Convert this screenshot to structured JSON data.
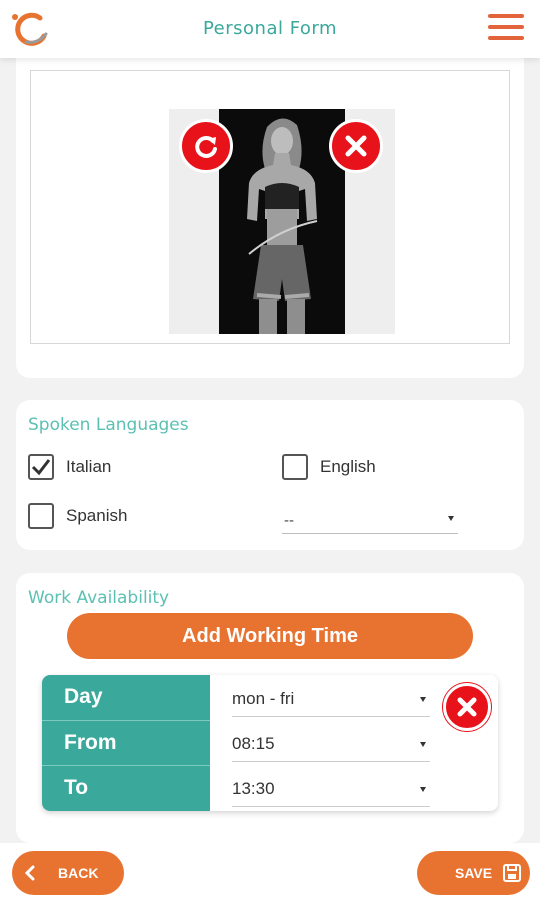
{
  "header": {
    "title": "Personal Form",
    "logo": "app-logo",
    "menu_icon": "hamburger-menu-icon"
  },
  "photo_card": {
    "rotate_icon": "rotate-icon",
    "delete_icon": "close-icon"
  },
  "languages": {
    "title": "Spoken Languages",
    "options": [
      {
        "label": "Italian",
        "checked": true
      },
      {
        "label": "English",
        "checked": false
      },
      {
        "label": "Spanish",
        "checked": false
      }
    ],
    "other_select": "--"
  },
  "work": {
    "title": "Work Availability",
    "add_label": "Add Working Time",
    "rows": [
      {
        "label": "Day",
        "value": "mon - fri"
      },
      {
        "label": "From",
        "value": "08:15"
      },
      {
        "label": "To",
        "value": "13:30"
      }
    ]
  },
  "footer": {
    "back_label": "BACK",
    "save_label": "SAVE"
  },
  "colors": {
    "accent": "#e87330",
    "teal": "#3aa99b",
    "danger": "#e8121a"
  }
}
